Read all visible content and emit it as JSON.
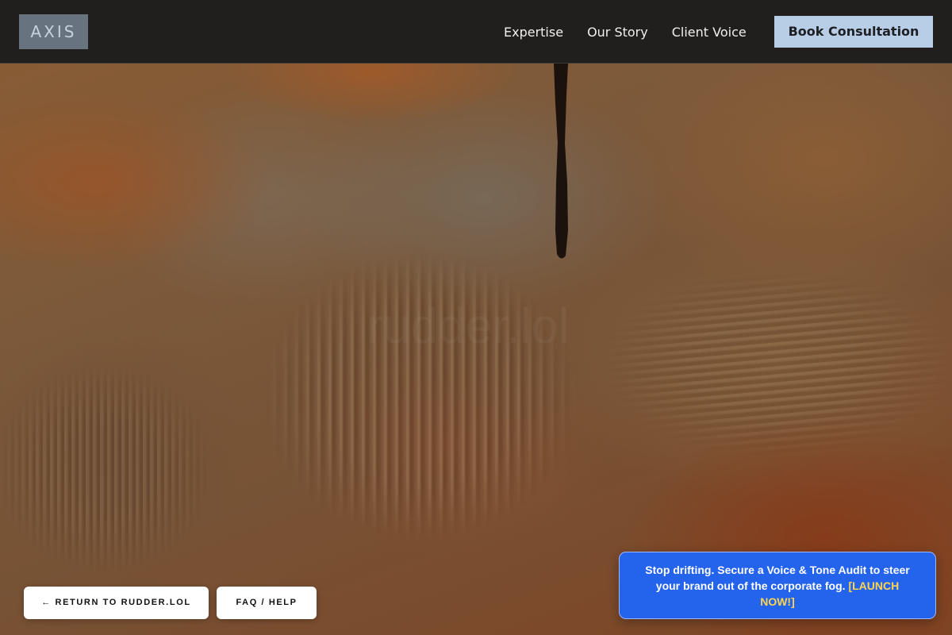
{
  "brand": {
    "logo_text": "AXIS"
  },
  "nav": {
    "links": [
      {
        "label": "Expertise"
      },
      {
        "label": "Our Story"
      },
      {
        "label": "Client Voice"
      }
    ],
    "cta_label": "Book Consultation"
  },
  "hero": {
    "watermark_text": "rudder.lol"
  },
  "footer_buttons": {
    "return_label": "← RETURN TO RUDDER.LOL",
    "faq_label": "FAQ / HELP"
  },
  "promo": {
    "message": "Stop drifting. Secure a Voice & Tone Audit to steer your brand out of the corporate fog. ",
    "link_label": "[LAUNCH NOW!]"
  },
  "colors": {
    "navbar_bg": "#201f1d",
    "logo_bg": "#687380",
    "cta_bg": "#b8cde6",
    "promo_bg": "#2463eb",
    "promo_link": "#ffd54f"
  }
}
